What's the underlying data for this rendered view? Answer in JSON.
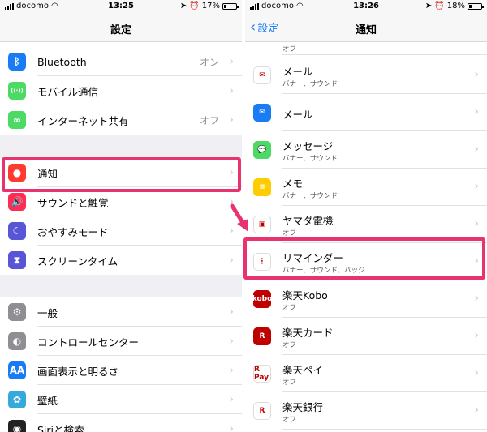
{
  "left": {
    "status": {
      "carrier": "docomo",
      "time": "13:25",
      "battery": "17%",
      "battery_level": 0.17
    },
    "nav": {
      "title": "設定"
    },
    "rows": [
      {
        "label": "Bluetooth",
        "value": "オン",
        "icon": "bluetooth-icon",
        "color": "#1a7cf5"
      },
      {
        "label": "モバイル通信",
        "value": "",
        "icon": "antenna-icon",
        "color": "#4cd964"
      },
      {
        "label": "インターネット共有",
        "value": "オフ",
        "icon": "link-icon",
        "color": "#4cd964"
      },
      {
        "label": "通知",
        "value": "",
        "icon": "notification-icon",
        "color": "#ff3b30"
      },
      {
        "label": "サウンドと触覚",
        "value": "",
        "icon": "speaker-icon",
        "color": "#ff2d55"
      },
      {
        "label": "おやすみモード",
        "value": "",
        "icon": "moon-icon",
        "color": "#5856d6"
      },
      {
        "label": "スクリーンタイム",
        "value": "",
        "icon": "hourglass-icon",
        "color": "#5856d6"
      },
      {
        "label": "一般",
        "value": "",
        "icon": "gear-icon",
        "color": "#8e8e93"
      },
      {
        "label": "コントロールセンター",
        "value": "",
        "icon": "toggles-icon",
        "color": "#8e8e93"
      },
      {
        "label": "画面表示と明るさ",
        "value": "",
        "icon": "text-size-icon",
        "color": "#1a7cf5"
      },
      {
        "label": "壁紙",
        "value": "",
        "icon": "flower-icon",
        "color": "#34aadc"
      },
      {
        "label": "Siriと検索",
        "value": "",
        "icon": "siri-icon",
        "color": "#222"
      }
    ]
  },
  "right": {
    "status": {
      "carrier": "docomo",
      "time": "13:26",
      "battery": "18%",
      "battery_level": 0.18
    },
    "nav": {
      "title": "通知",
      "back": "設定"
    },
    "top_partial": "オフ",
    "rows": [
      {
        "title": "メール",
        "sub": "バナー、サウンド",
        "icon": "yamato-mail-icon",
        "color": "#ffffff"
      },
      {
        "title": "メール",
        "sub": "",
        "icon": "mail-icon",
        "color": "#1a7cf5"
      },
      {
        "title": "メッセージ",
        "sub": "バナー、サウンド",
        "icon": "message-icon",
        "color": "#4cd964"
      },
      {
        "title": "メモ",
        "sub": "バナー、サウンド",
        "icon": "notes-icon",
        "color": "#ffcc00"
      },
      {
        "title": "ヤマダ電機",
        "sub": "オフ",
        "icon": "yamada-icon",
        "color": "#ffffff"
      },
      {
        "title": "リマインダー",
        "sub": "バナー、サウンド、バッジ",
        "icon": "reminders-icon",
        "color": "#ffffff"
      },
      {
        "title": "楽天Kobo",
        "sub": "オフ",
        "icon": "kobo-icon",
        "color": "#bf0000"
      },
      {
        "title": "楽天カード",
        "sub": "オフ",
        "icon": "rakuten-card-icon",
        "color": "#bf0000"
      },
      {
        "title": "楽天ペイ",
        "sub": "オフ",
        "icon": "rakuten-pay-icon",
        "color": "#ffffff"
      },
      {
        "title": "楽天銀行",
        "sub": "オフ",
        "icon": "rakuten-bank-icon",
        "color": "#ffffff"
      }
    ],
    "icon_text": {
      "kobo": "kobo",
      "pay": "R Pay",
      "card": "R",
      "bank": "R"
    }
  },
  "accent": "#e8336e"
}
